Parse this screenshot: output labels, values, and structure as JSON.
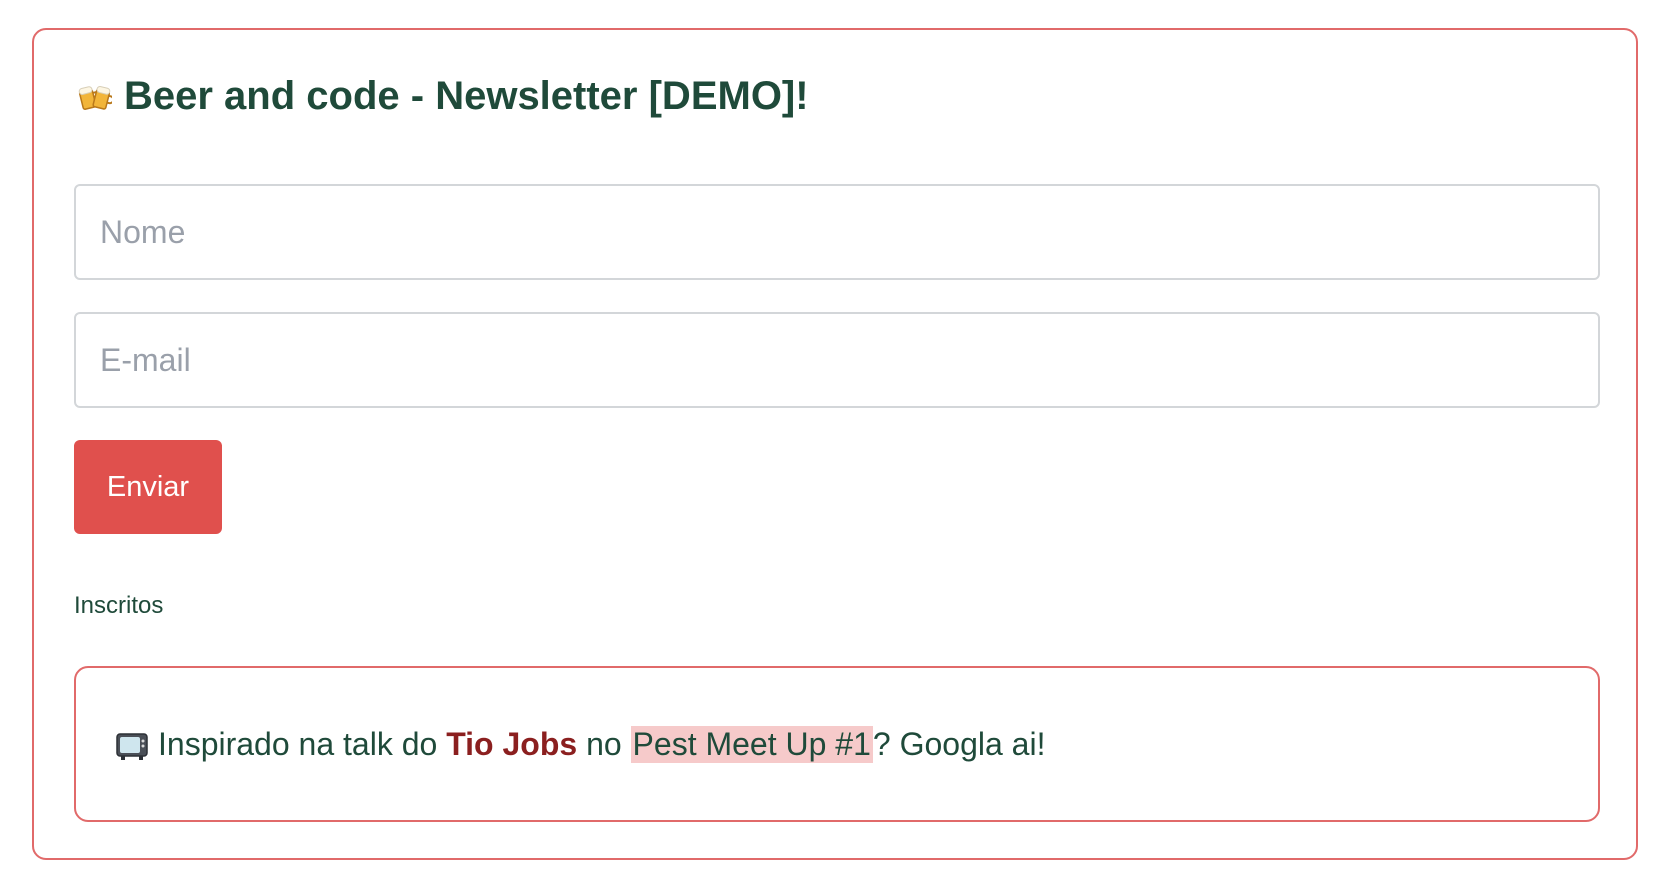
{
  "header": {
    "title": "Beer and code - Newsletter [DEMO]!",
    "icon": "beer-mugs-icon"
  },
  "form": {
    "name_placeholder": "Nome",
    "email_placeholder": "E-mail",
    "submit_label": "Enviar"
  },
  "subscribers": {
    "label": "Inscritos"
  },
  "note": {
    "icon": "tv-icon",
    "prefix": "Inspirado na talk do",
    "speaker": "Tio Jobs",
    "middle": "no",
    "event": "Pest Meet Up #1",
    "suffix": "? Googla ai!"
  },
  "colors": {
    "accent": "#e0504d",
    "border": "#e16a6a",
    "text": "#1f4a3a",
    "speaker": "#8b1f1f",
    "highlight": "#f6caca"
  }
}
